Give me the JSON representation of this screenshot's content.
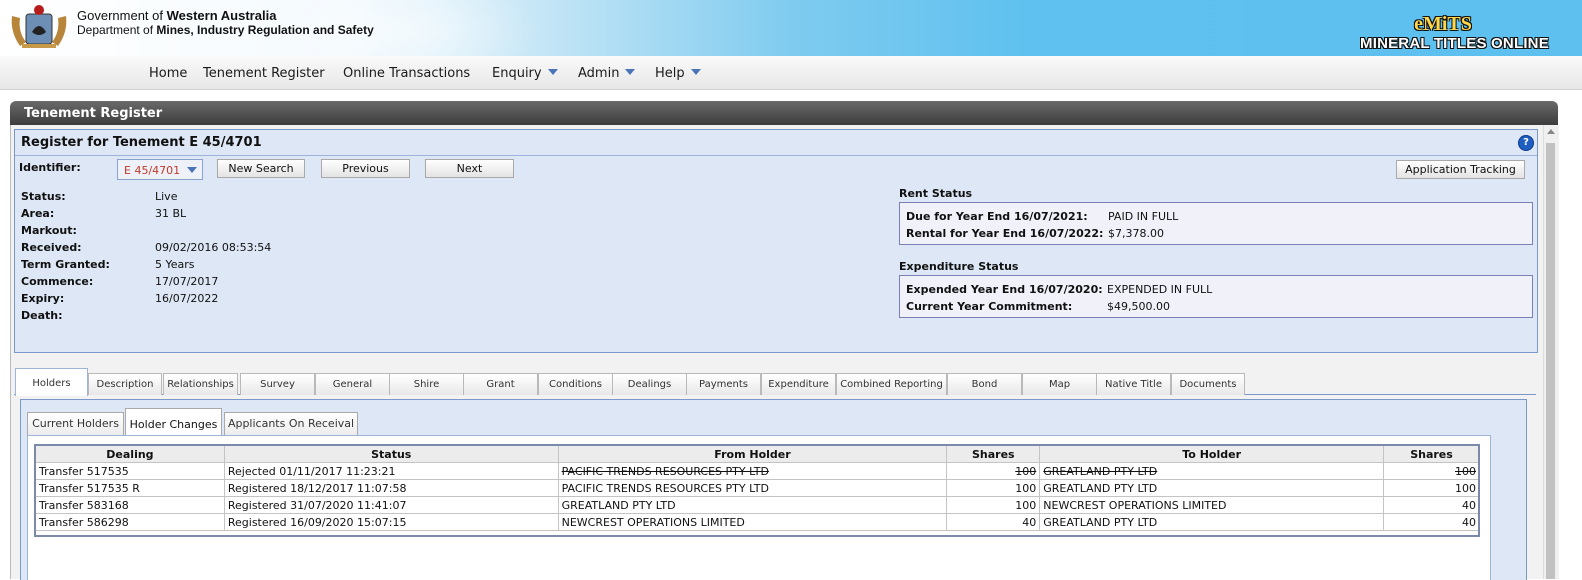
{
  "header": {
    "gov_prefix": "Government of ",
    "gov_name": "Western Australia",
    "dept_prefix": "Department of ",
    "dept_name": "Mines, Industry Regulation and Safety",
    "app_logo": "eMiTS",
    "app_name": "MINERAL TITLES ONLINE"
  },
  "nav": {
    "items": [
      {
        "label": "Home"
      },
      {
        "label": "Tenement Register"
      },
      {
        "label": "Online Transactions"
      },
      {
        "label": "Enquiry"
      },
      {
        "label": "Admin"
      },
      {
        "label": "Help"
      }
    ]
  },
  "panel": {
    "title": "Tenement Register",
    "register_title": "Register for Tenement E 45/4701",
    "help_icon": "?"
  },
  "identifier": {
    "label": "Identifier:",
    "value": "E 45/4701",
    "buttons": {
      "new_search": "New Search",
      "previous": "Previous",
      "next": "Next",
      "application_tracking": "Application Tracking"
    }
  },
  "details": [
    {
      "label": "Status:",
      "value": "Live"
    },
    {
      "label": "Area:",
      "value": "31 BL"
    },
    {
      "label": "Markout:",
      "value": ""
    },
    {
      "label": "Received:",
      "value": "09/02/2016 08:53:54"
    },
    {
      "label": "Term Granted:",
      "value": "5 Years"
    },
    {
      "label": "Commence:",
      "value": "17/07/2017"
    },
    {
      "label": "Expiry:",
      "value": "16/07/2022"
    },
    {
      "label": "Death:",
      "value": ""
    }
  ],
  "rent_status": {
    "title": "Rent Status",
    "rows": [
      {
        "label": "Due for Year End 16/07/2021:",
        "value": "PAID IN FULL"
      },
      {
        "label": "Rental for Year End 16/07/2022:",
        "value": "$7,378.00"
      }
    ]
  },
  "expenditure_status": {
    "title": "Expenditure Status",
    "rows": [
      {
        "label": "Expended Year End 16/07/2020:",
        "value": "EXPENDED IN FULL"
      },
      {
        "label": "Current Year Commitment:",
        "value": "$49,500.00"
      }
    ]
  },
  "tabs": [
    "Holders",
    "Description",
    "Relationships",
    "Survey",
    "General",
    "Shire",
    "Grant",
    "Conditions",
    "Dealings",
    "Payments",
    "Expenditure",
    "Combined Reporting",
    "Bond",
    "Map",
    "Native Title",
    "Documents"
  ],
  "subtabs": [
    "Current Holders",
    "Holder Changes",
    "Applicants On Receival"
  ],
  "holder_changes": {
    "columns": [
      "Dealing",
      "Status",
      "From Holder",
      "Shares",
      "To Holder",
      "Shares"
    ],
    "rows": [
      {
        "dealing": "Transfer 517535",
        "status": "Rejected 01/11/2017 11:23:21",
        "from": "PACIFIC TRENDS RESOURCES PTY LTD",
        "from_shares": "100",
        "to": "GREATLAND PTY LTD",
        "to_shares": "100"
      },
      {
        "dealing": "Transfer 517535 R",
        "status": "Registered 18/12/2017 11:07:58",
        "from": "PACIFIC TRENDS RESOURCES PTY LTD",
        "from_shares": "100",
        "to": "GREATLAND PTY LTD",
        "to_shares": "100"
      },
      {
        "dealing": "Transfer 583168",
        "status": "Registered 31/07/2020 11:41:07",
        "from": "GREATLAND PTY LTD",
        "from_shares": "100",
        "to": "NEWCREST OPERATIONS LIMITED",
        "to_shares": "40"
      },
      {
        "dealing": "Transfer 586298",
        "status": "Registered 16/09/2020 15:07:15",
        "from": "NEWCREST OPERATIONS LIMITED",
        "from_shares": "40",
        "to": "GREATLAND PTY LTD",
        "to_shares": "40"
      }
    ]
  }
}
